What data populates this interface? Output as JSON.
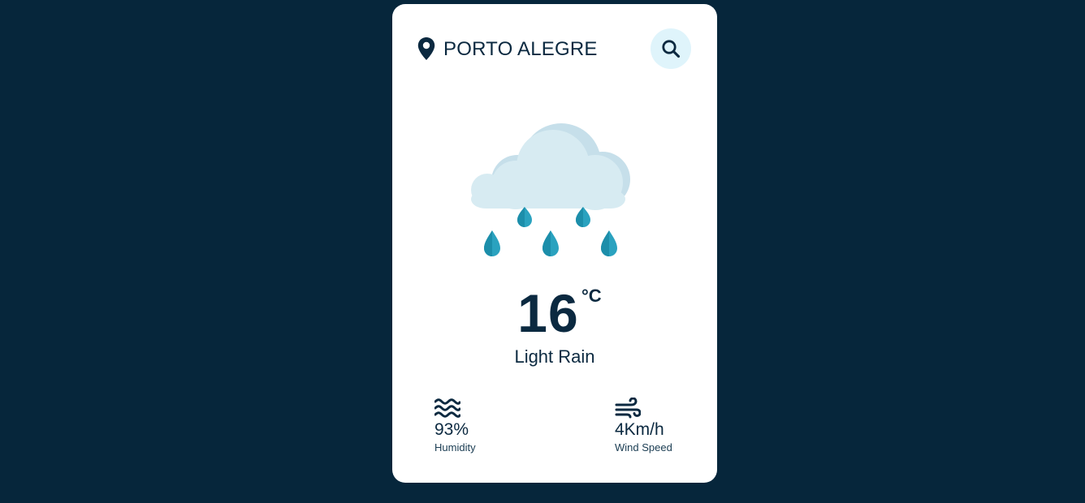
{
  "app": {
    "background_color": "#06263b",
    "card_color": "#ffffff",
    "accent_color": "#dff4fb",
    "text_color": "#0b2940"
  },
  "header": {
    "location_icon": "location-pin-icon",
    "city": "PORTO ALEGRE",
    "search_icon": "search-icon"
  },
  "weather": {
    "icon": "rain-cloud-icon",
    "temperature": "16",
    "unit": "°C",
    "description": "Light Rain"
  },
  "stats": {
    "humidity": {
      "icon": "humidity-waves-icon",
      "value": "93%",
      "label": "Humidity"
    },
    "wind": {
      "icon": "wind-icon",
      "value": "4Km/h",
      "label": "Wind Speed"
    }
  }
}
